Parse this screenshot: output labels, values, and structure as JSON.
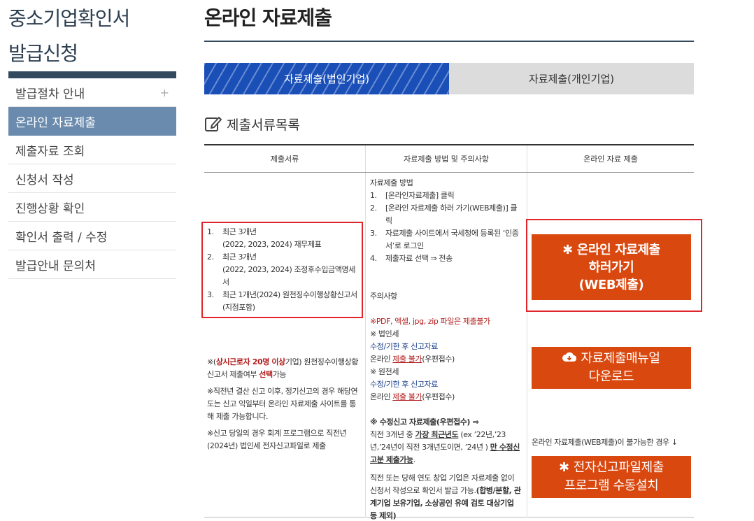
{
  "sidebar": {
    "title_line1": "중소기업확인서",
    "title_line2": "발급신청",
    "items": [
      {
        "label": "발급절차 안내",
        "plus": "+"
      },
      {
        "label": "온라인 자료제출"
      },
      {
        "label": "제출자료 조회"
      },
      {
        "label": "신청서 작성"
      },
      {
        "label": "진행상황 확인"
      },
      {
        "label": "확인서 출력 / 수정"
      },
      {
        "label": "발급안내 문의처"
      }
    ]
  },
  "main": {
    "title": "온라인 자료제출",
    "tabs": [
      {
        "label": "자료제출(법인기업)"
      },
      {
        "label": "자료제출(개인기업)"
      }
    ],
    "section_title": "제출서류목록"
  },
  "table": {
    "headers": [
      "제출서류",
      "자료제출 방법 및 주의사항",
      "온라인 자료 제출"
    ],
    "docs": [
      {
        "num": "1.",
        "line1": "최근 3개년",
        "line2": "(2022, 2023, 2024) 재무제표"
      },
      {
        "num": "2.",
        "line1": "최근 3개년",
        "line2": "(2022, 2023, 2024) 조정후수입금액명세서"
      },
      {
        "num": "3.",
        "line1": "최근 1개년(2024) 원천징수이행상황신고서",
        "line2": "(지점포함)"
      }
    ],
    "note1": {
      "p1_pre": "※(",
      "p1_red": "상시근로자 20명 이상",
      "p1_mid": "기업) 원천징수이행상황신고서 제출여부 ",
      "p1_red2": "선택",
      "p1_post": "가능",
      "p2": "※직전년 결산 신고 이후, 정기신고의 경우 해당연도는 신고 익일부터 온라인 자료제출 사이트를 통해 제출 가능합니다.",
      "p3": "※신고 당일의 경우 회계 프로그램으로 직전년(2024년) 법인세 전자신고파일로 제출"
    },
    "method": {
      "heading": "자료제출 방법",
      "steps": [
        {
          "num": "1.",
          "text": "[온라인자료제출] 클릭"
        },
        {
          "num": "2.",
          "text": "[온라인 자료제출 하러 가기(WEB제출)] 클릭"
        },
        {
          "num": "3.",
          "text": "자료제출 사이트에서 국세청에 등록된 ‘인증서’로 로그인"
        },
        {
          "num": "4.",
          "text": "제출자료 선택 ⇒ 전송"
        }
      ],
      "caution_heading": "주의사항",
      "caution_red": "※PDF, 엑셀, jpg, zip 파일은 제출불가",
      "corp_tax": "※ 법인세",
      "revise1": "수정/기한 후 신고자료",
      "online_pre1": "온라인 ",
      "online_red1": "제출 불가",
      "online_post1": "(우편접수)",
      "withholding": "※ 원천세",
      "revise2": "수정/기한 후 신고자료",
      "online_pre2": "온라인 ",
      "online_red2": "제출 불가",
      "online_post2": "(우편접수)",
      "revise_heading": "※ 수정신고 자료제출(우편접수) ⇒",
      "revise_pre": "직전 3개년 중 ",
      "revise_u": "가장 최근년도",
      "revise_mid": " (ex ’22년,’23년,’24년이 직전 3개년도이면, ’24년 ) ",
      "revise_u2": "만 수정신고분 제출가능",
      "revise_post": ".",
      "startup_pre": "직전 또는 당해 연도 창업 기업은 자료제출 없이 신청서 작성으로 확인서 발급 가능.",
      "startup_bold": "(합병/분할, 관계기업 보유기업, 소상공인 유예 검토 대상기업 등 제외)"
    },
    "online": {
      "web_line1": "온라인 자료제출",
      "web_line2": "하러가기",
      "web_line3": "(WEB제출)",
      "manual_line1": "자료제출매뉴얼",
      "manual_line2": "다운로드",
      "unavailable_note": "온라인 자료제출(WEB제출)이 불가능한 경우 ↓",
      "install_line1": "전자신고파일제출",
      "install_line2": "프로그램 수동설치"
    }
  },
  "colors": {
    "accent_blue": "#1a4fb8",
    "sidebar_active": "#6a8bad",
    "orange_button": "#d9480f",
    "highlight_red": "#e0262c"
  }
}
